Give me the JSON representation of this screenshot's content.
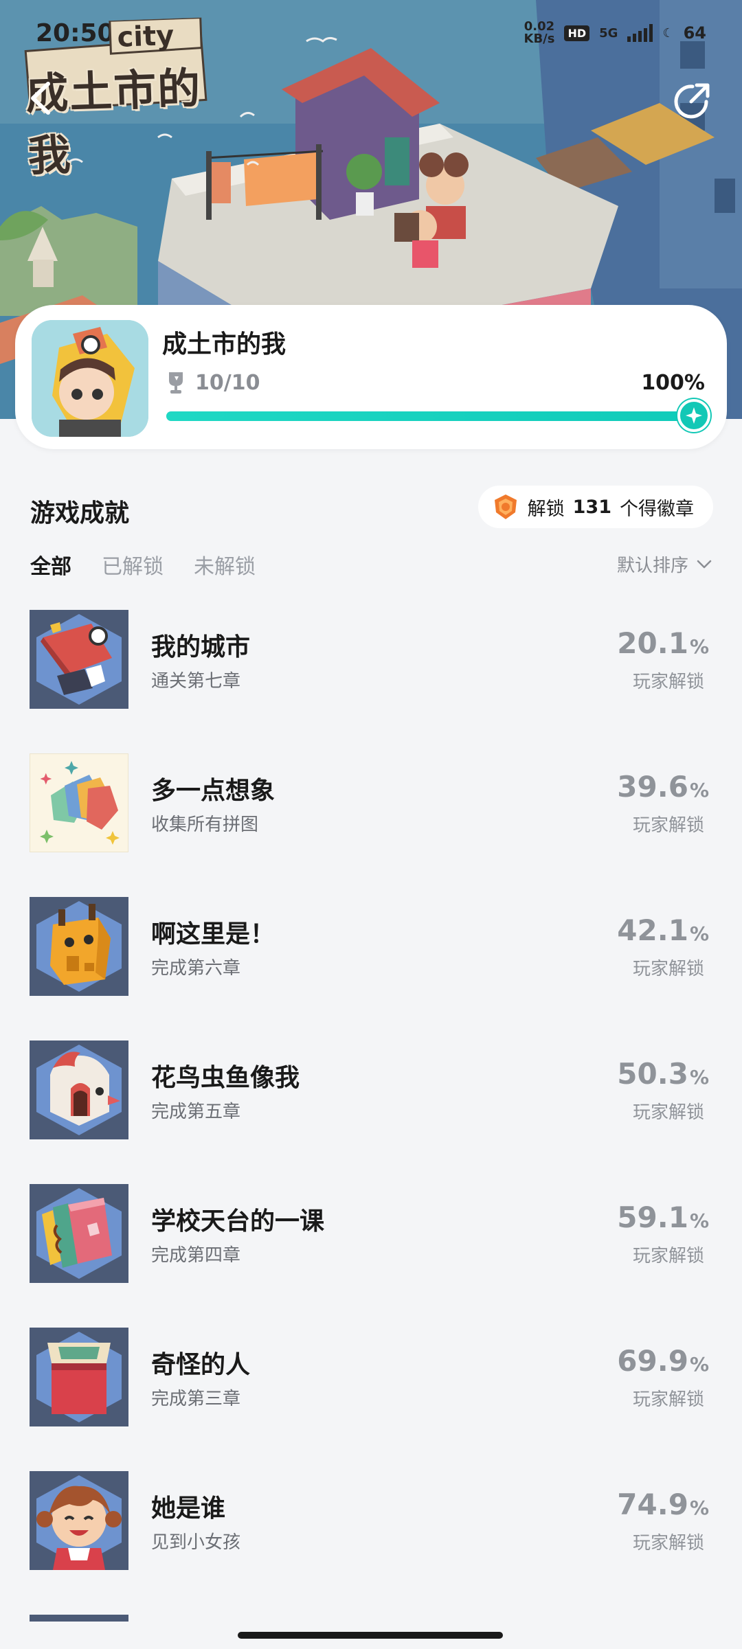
{
  "status_bar": {
    "time": "20:50",
    "speed_value": "0.02",
    "speed_unit": "KB/s",
    "hd": "HD",
    "network": "5G",
    "battery": "64"
  },
  "hero": {
    "logo_title": "成土市的我",
    "logo_city": "city"
  },
  "game": {
    "name": "成土市的我",
    "progress_text": "10/10",
    "progress_percent_text": "100%",
    "progress_fraction": 1.0
  },
  "section": {
    "title": "游戏成就",
    "badge_prefix": "解锁",
    "badge_count": "131",
    "badge_suffix": "个得徽章"
  },
  "tabs": [
    {
      "label": "全部",
      "active": true
    },
    {
      "label": "已解锁",
      "active": false
    },
    {
      "label": "未解锁",
      "active": false
    }
  ],
  "sort": {
    "label": "默认排序"
  },
  "achievements": [
    {
      "name": "我的城市",
      "desc": "通关第七章",
      "rate": "20.1",
      "pct": "%",
      "rate_label": "玩家解锁",
      "icon": "red-hat-character-icon"
    },
    {
      "name": "多一点想象",
      "desc": "收集所有拼图",
      "rate": "39.6",
      "pct": "%",
      "rate_label": "玩家解锁",
      "icon": "puzzle-blocks-icon"
    },
    {
      "name": "啊这里是！",
      "desc": "完成第六章",
      "rate": "42.1",
      "pct": "%",
      "rate_label": "玩家解锁",
      "icon": "giraffe-block-icon"
    },
    {
      "name": "花鸟虫鱼像我",
      "desc": "完成第五章",
      "rate": "50.3",
      "pct": "%",
      "rate_label": "玩家解锁",
      "icon": "bird-block-icon"
    },
    {
      "name": "学校天台的一课",
      "desc": "完成第四章",
      "rate": "59.1",
      "pct": "%",
      "rate_label": "玩家解锁",
      "icon": "books-icon"
    },
    {
      "name": "奇怪的人",
      "desc": "完成第三章",
      "rate": "69.9",
      "pct": "%",
      "rate_label": "玩家解锁",
      "icon": "red-box-icon"
    },
    {
      "name": "她是谁",
      "desc": "见到小女孩",
      "rate": "74.9",
      "pct": "%",
      "rate_label": "玩家解锁",
      "icon": "girl-face-icon"
    }
  ]
}
